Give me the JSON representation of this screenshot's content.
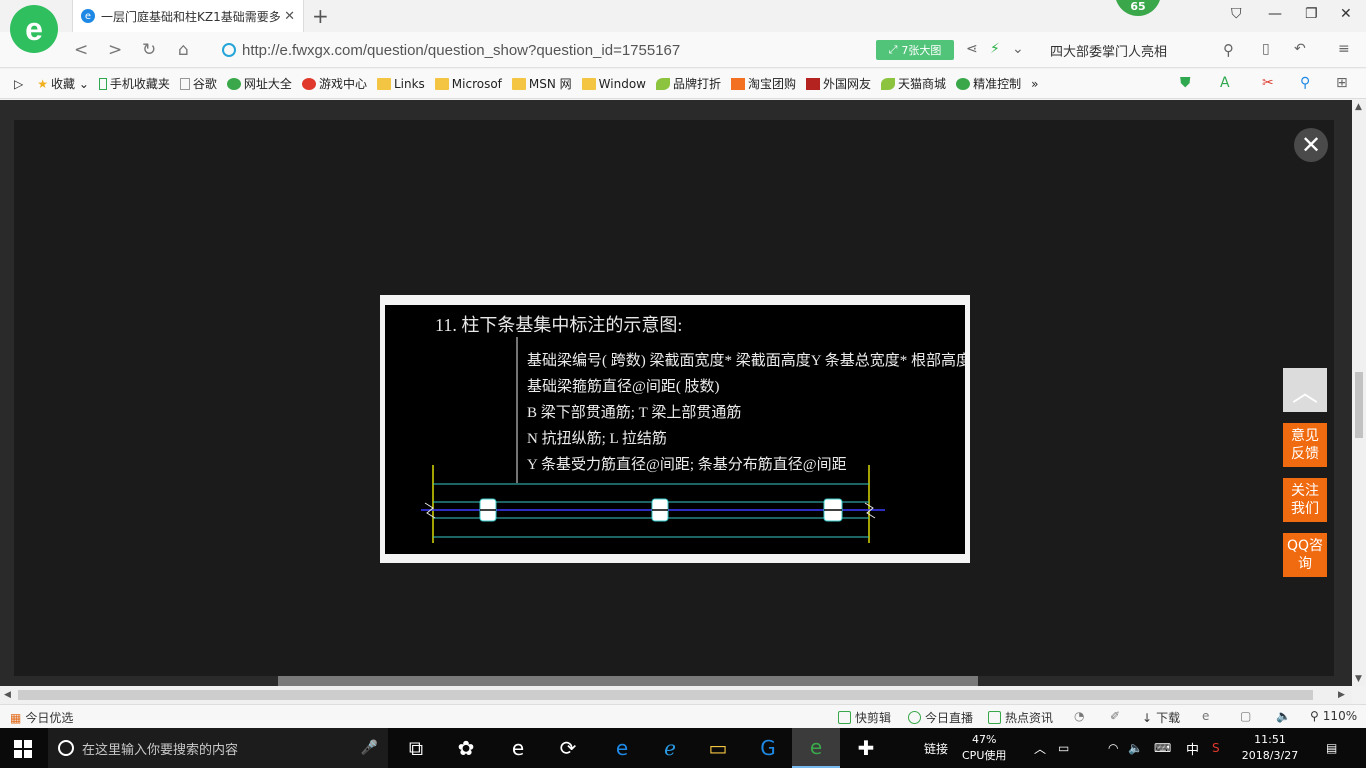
{
  "browser": {
    "tab_title": "一层门庭基础和柱KZ1基础需要多",
    "badge": "65",
    "url": "http://e.fwxgx.com/question/question_show?question_id=1755167",
    "bigimg_label": "7张大图",
    "search_text": "四大部委掌门人亮相"
  },
  "bookmarks": [
    {
      "label": "收藏"
    },
    {
      "label": "手机收藏夹"
    },
    {
      "label": "谷歌"
    },
    {
      "label": "网址大全"
    },
    {
      "label": "游戏中心"
    },
    {
      "label": "Links"
    },
    {
      "label": "Microsof"
    },
    {
      "label": "MSN 网"
    },
    {
      "label": "Window"
    },
    {
      "label": "品牌打折"
    },
    {
      "label": "淘宝团购"
    },
    {
      "label": "外国网友"
    },
    {
      "label": "天猫商城"
    },
    {
      "label": "精准控制"
    }
  ],
  "viewer": {
    "cad_title": "11. 柱下条基集中标注的示意图:",
    "cad_lines": [
      "基础梁编号( 跨数) 梁截面宽度* 梁截面高度Y 条基总宽度* 根部高度* 端部高度",
      "基础梁箍筋直径@间距( 肢数)",
      "B 梁下部贯通筋; T 梁上部贯通筋",
      "N 抗扭纵筋; L 拉结筋",
      "Y 条基受力筋直径@间距; 条基分布筋直径@间距"
    ]
  },
  "side_buttons": {
    "feedback": "意见反馈",
    "follow": "关注我们",
    "qq": "QQ咨询"
  },
  "statusbar": {
    "left": "今日优选",
    "kuaijianji": "快剪辑",
    "live": "今日直播",
    "news": "热点资讯",
    "download": "下载",
    "zoom": "110%"
  },
  "taskbar": {
    "search_placeholder": "在这里输入你要搜索的内容",
    "links_label": "链接",
    "cpu_percent": "47%",
    "cpu_label": "CPU使用",
    "ime": "中",
    "time": "11:51",
    "date": "2018/3/27"
  }
}
